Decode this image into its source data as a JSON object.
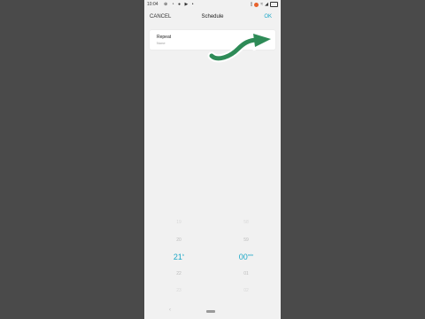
{
  "status": {
    "time": "10:04",
    "left_icons": [
      "notification-icon",
      "whatsapp-icon",
      "camera-icon",
      "media-icon",
      "dot-icon"
    ],
    "right_icons": [
      "vibrate-icon",
      "alarm-icon",
      "wifi-icon",
      "signal-icon",
      "battery-icon"
    ]
  },
  "header": {
    "cancel": "CANCEL",
    "title": "Schedule",
    "ok": "OK"
  },
  "repeat": {
    "label": "Repeat",
    "value": "None"
  },
  "picker": {
    "hours": {
      "above2": "19",
      "above1": "20",
      "selected": "21",
      "unit": "h",
      "below1": "22",
      "below2": "23"
    },
    "minutes": {
      "above2": "58",
      "above1": "59",
      "selected": "00",
      "unit": "min",
      "below1": "01",
      "below2": "02"
    }
  },
  "annotation": {
    "arrow_color": "#2e8b57"
  }
}
